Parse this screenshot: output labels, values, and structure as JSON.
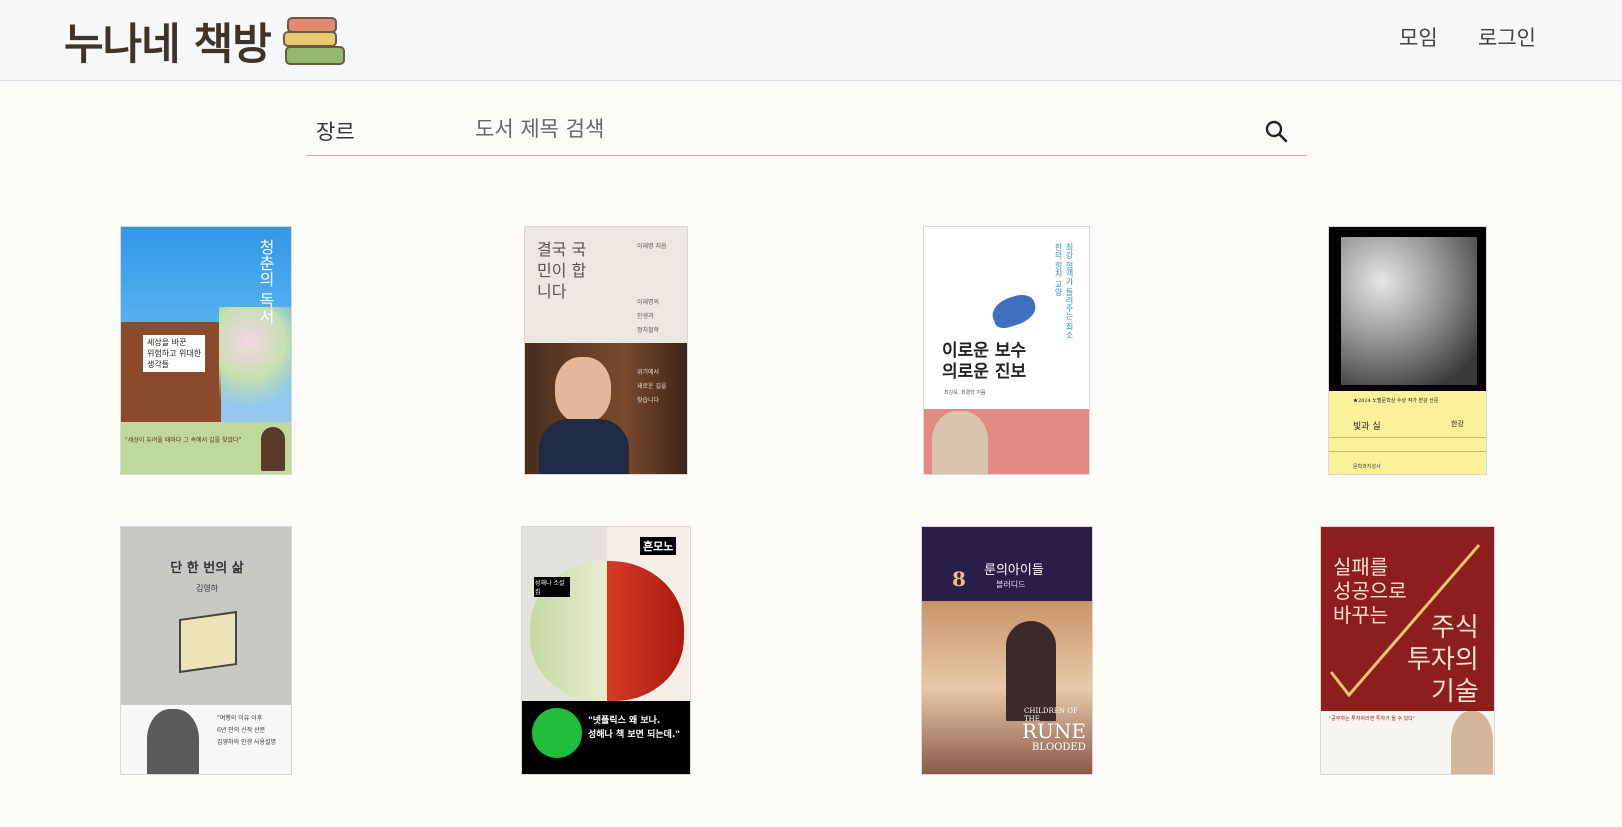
{
  "header": {
    "logo_text": "누나네 책방",
    "nav": {
      "meetings": "모임",
      "login": "로그인"
    }
  },
  "search": {
    "genre_label": "장르",
    "placeholder": "도서 제목 검색",
    "icon": "search-icon"
  },
  "books": [
    {
      "title": "청춘의 독서",
      "cover_lines": [
        "세상을 바꾼",
        "위험하고 위대한",
        "생각들"
      ],
      "tagline": "\"세상이 두려울 때마다 그 속에서 길을 찾았다\""
    },
    {
      "title": "결국 국민이 합니다",
      "cover_lines": [
        "이재명의",
        "인생과",
        "정치철학"
      ],
      "author": "이재명 지음",
      "side": [
        "위기에서",
        "새로운 길을",
        "찾습니다"
      ]
    },
    {
      "title": "이로운 보수 의로운 진보",
      "vertical": "최강 협객가 들려주는 최소한의 정치 교양",
      "authors": "최강욱, 최경혁 지음"
    },
    {
      "title": "빛과 실",
      "badge": "★2024 노벨문학상 수상 작가 한강 산문",
      "author": "한강",
      "publisher": "문학과지성사"
    },
    {
      "title": "단 한 번의 삶",
      "author": "김영하",
      "quote_lines": [
        "\"여행의 이유 이후",
        "6년 만의 신작 산문",
        "김영하의 인생 사용설명"
      ]
    },
    {
      "title": "흔모노",
      "author_label": "성해나 소설집",
      "quote_lines": [
        "\"넷플릭스 왜 보나.",
        "성해나 책 보면 되는데.\""
      ]
    },
    {
      "title": "룬의아이들",
      "subtitle": "블러디드",
      "en_lines": [
        "CHILDREN OF THE",
        "RUNE",
        "BLOODED"
      ],
      "series": "8"
    },
    {
      "title_lines": [
        "실패를",
        "성공으로",
        "바꾸는"
      ],
      "title2_lines": [
        "주식",
        "투자의",
        "기술"
      ],
      "quote": "\"공부하는 투자자라면 투자가 될 수 있다\""
    }
  ]
}
